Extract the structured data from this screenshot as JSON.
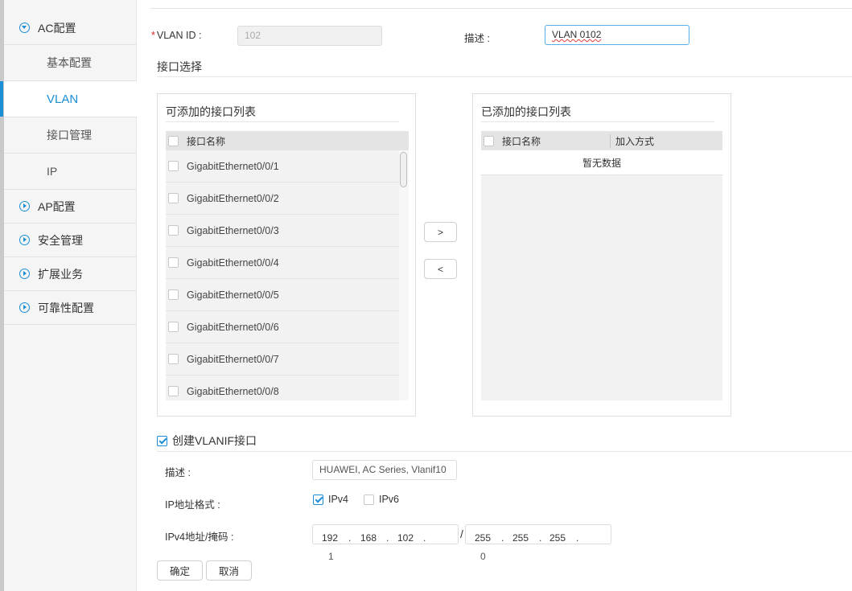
{
  "sidebar": {
    "groups": [
      {
        "label": "AC配置",
        "expanded": true
      },
      {
        "label": "AP配置",
        "expanded": false
      },
      {
        "label": "安全管理",
        "expanded": false
      },
      {
        "label": "扩展业务",
        "expanded": false
      },
      {
        "label": "可靠性配置",
        "expanded": false
      }
    ],
    "ac_items": [
      {
        "label": "基本配置",
        "active": false
      },
      {
        "label": "VLAN",
        "active": true
      },
      {
        "label": "接口管理",
        "active": false
      },
      {
        "label": "IP",
        "active": false
      }
    ]
  },
  "form": {
    "required_mark": "*",
    "vlan_id_label": "VLAN ID :",
    "vlan_id_value": "102",
    "desc_label": "描述 :",
    "desc_value": "VLAN 0102"
  },
  "interface_section": {
    "title": "接口选择",
    "available": {
      "title": "可添加的接口列表",
      "column": "接口名称",
      "rows": [
        "GigabitEthernet0/0/1",
        "GigabitEthernet0/0/2",
        "GigabitEthernet0/0/3",
        "GigabitEthernet0/0/4",
        "GigabitEthernet0/0/5",
        "GigabitEthernet0/0/6",
        "GigabitEthernet0/0/7",
        "GigabitEthernet0/0/8"
      ]
    },
    "added": {
      "title": "已添加的接口列表",
      "columns": [
        "接口名称",
        "加入方式"
      ],
      "empty_text": "暂无数据"
    },
    "move_right_label": ">",
    "move_left_label": "<"
  },
  "vlanif": {
    "checkbox_label": "创建VLANIF接口",
    "checked": true,
    "desc_label": "描述 :",
    "desc_value": "HUAWEI, AC Series, Vlanif10",
    "ip_format_label": "IP地址格式 :",
    "ipv4_label": "IPv4",
    "ipv4_checked": true,
    "ipv6_label": "IPv6",
    "ipv6_checked": false,
    "ipv4_addr_label": "IPv4地址/掩码 :",
    "ip": [
      "192",
      "168",
      "102"
    ],
    "ip_last": "1",
    "slash": "/",
    "mask": [
      "255",
      "255",
      "255"
    ],
    "mask_last": "0",
    "dot": "."
  },
  "actions": {
    "ok_label": "确定",
    "cancel_label": "取消"
  }
}
